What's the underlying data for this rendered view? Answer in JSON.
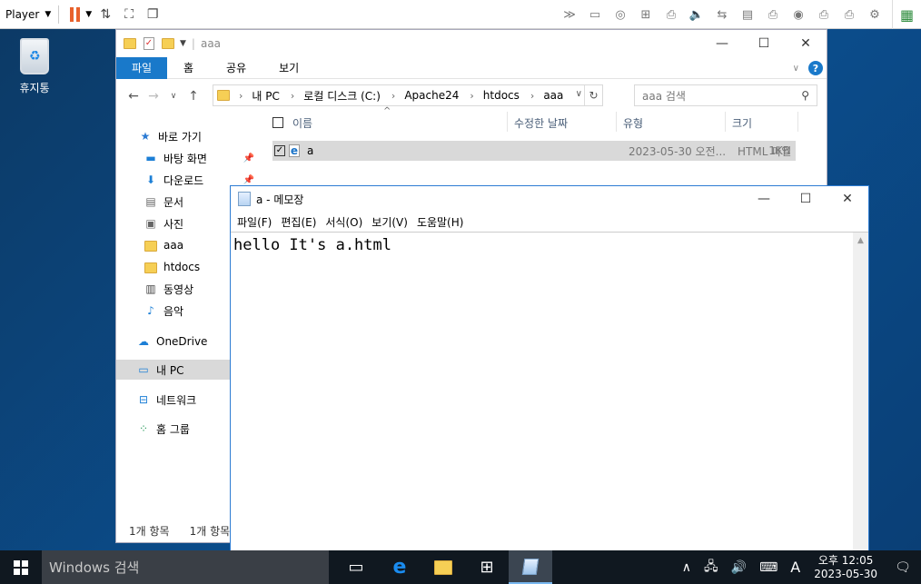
{
  "player": {
    "label": "Player"
  },
  "desktop": {
    "recycle_bin": "휴지통"
  },
  "explorer": {
    "title": "aaa",
    "ribbon": {
      "file_tab": "파일",
      "tabs": [
        "홈",
        "공유",
        "보기"
      ]
    },
    "address": {
      "segments": [
        "내 PC",
        "로컬 디스크 (C:)",
        "Apache24",
        "htdocs",
        "aaa"
      ]
    },
    "search_placeholder": "aaa 검색",
    "nav": {
      "quick_access": "바로 가기",
      "items": [
        "바탕 화면",
        "다운로드",
        "문서",
        "사진",
        "aaa",
        "htdocs",
        "동영상",
        "음악"
      ],
      "onedrive": "OneDrive",
      "this_pc": "내 PC",
      "network": "네트워크",
      "homegroup": "홈 그룹"
    },
    "columns": {
      "name": "이름",
      "modified": "수정한 날짜",
      "type": "유형",
      "size": "크기"
    },
    "files": [
      {
        "name": "a",
        "modified": "2023-05-30 오전...",
        "type": "HTML 파일",
        "size": "1KB"
      }
    ],
    "status": {
      "count": "1개 항목",
      "selected": "1개 항목"
    }
  },
  "notepad": {
    "title": "a - 메모장",
    "menu": [
      "파일(F)",
      "편집(E)",
      "서식(O)",
      "보기(V)",
      "도움말(H)"
    ],
    "content": "hello It's a.html"
  },
  "taskbar": {
    "search_placeholder": "Windows 검색",
    "ime": "A",
    "time": "오후 12:05",
    "date": "2023-05-30"
  }
}
